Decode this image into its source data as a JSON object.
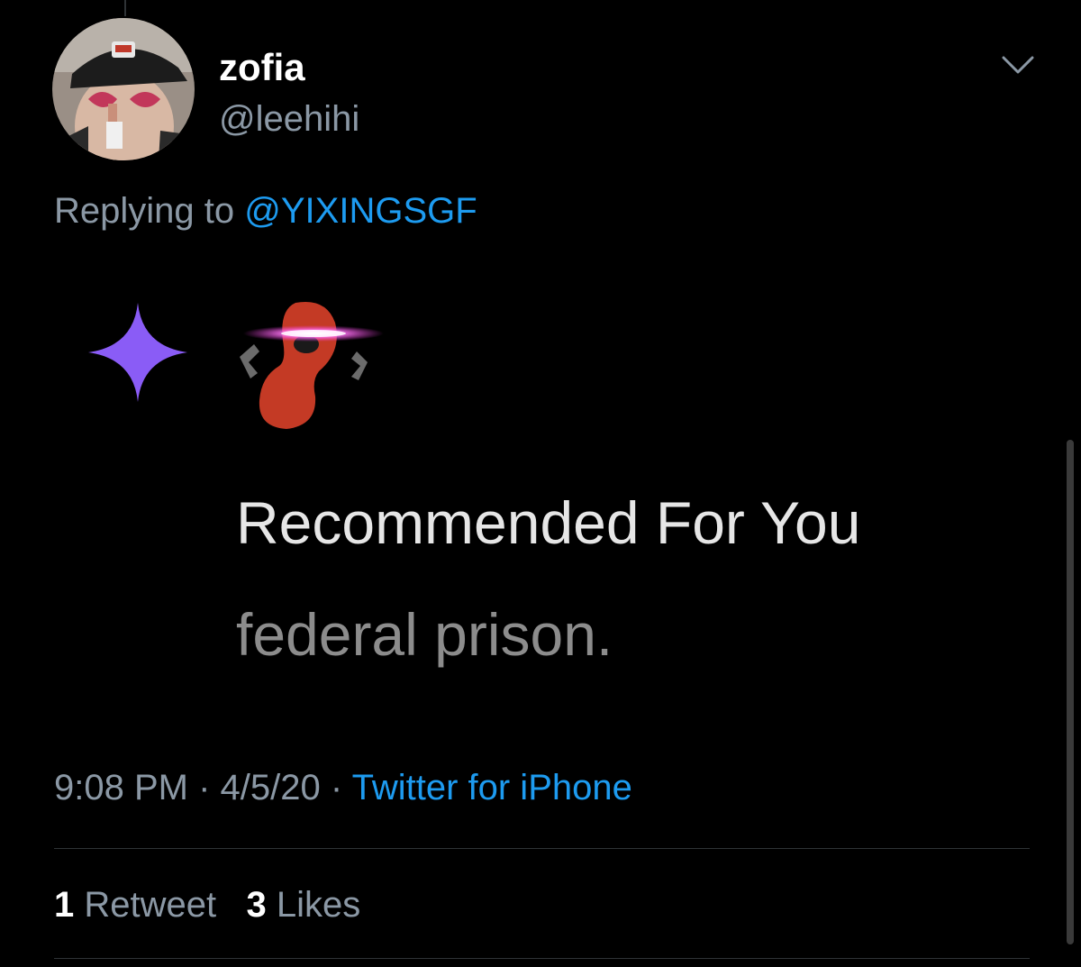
{
  "tweet": {
    "display_name": "zofia",
    "handle": "@leehihi",
    "replying_prefix": "Replying to",
    "replying_to": "@YIXINGSGF",
    "image": {
      "title": "Recommended For You",
      "subtitle": "federal prison."
    },
    "time": "9:08 PM",
    "separator": "·",
    "date": "4/5/20",
    "source": "Twitter for iPhone",
    "retweet_count": "1",
    "retweet_label": "Retweet",
    "likes_count": "3",
    "likes_label": "Likes"
  },
  "icons": {
    "menu": "chevron-down-icon",
    "sparkle": "sparkle-icon",
    "bean": "bean-character-icon"
  },
  "colors": {
    "background": "#000000",
    "link": "#1d9bf0",
    "secondary_text": "#8b98a5",
    "sparkle": "#8a5cf6",
    "bean": "#c43a25",
    "glow": "#ff3cf0"
  }
}
